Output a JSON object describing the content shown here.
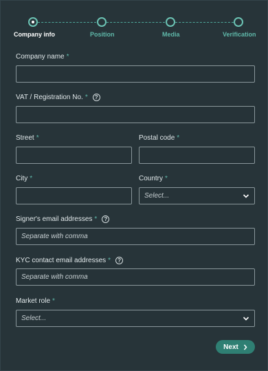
{
  "stepper": {
    "steps": [
      {
        "label": "Company info"
      },
      {
        "label": "Position"
      },
      {
        "label": "Media"
      },
      {
        "label": "Verification"
      }
    ],
    "active_index": 0
  },
  "form": {
    "company_name": {
      "label": "Company name",
      "required": "*",
      "value": ""
    },
    "vat": {
      "label": "VAT / Registration No.",
      "required": "*",
      "help_icon": "?",
      "value": ""
    },
    "street": {
      "label": "Street",
      "required": "*",
      "value": ""
    },
    "postal_code": {
      "label": "Postal code",
      "required": "*",
      "value": ""
    },
    "city": {
      "label": "City",
      "required": "*",
      "value": ""
    },
    "country": {
      "label": "Country",
      "required": "*",
      "selected": "Select..."
    },
    "signer_emails": {
      "label": "Signer's email addresses",
      "required": "*",
      "help_icon": "?",
      "placeholder": "Separate with comma"
    },
    "kyc_emails": {
      "label": "KYC contact email addresses",
      "required": "*",
      "help_icon": "?",
      "placeholder": "Separate with comma"
    },
    "market_role": {
      "label": "Market role",
      "required": "*",
      "selected": "Select..."
    }
  },
  "actions": {
    "next_label": "Next",
    "next_icon": "chevron-right-icon"
  },
  "colors": {
    "accent": "#5fb8a9",
    "button": "#2f7f73",
    "background": "#273439"
  }
}
